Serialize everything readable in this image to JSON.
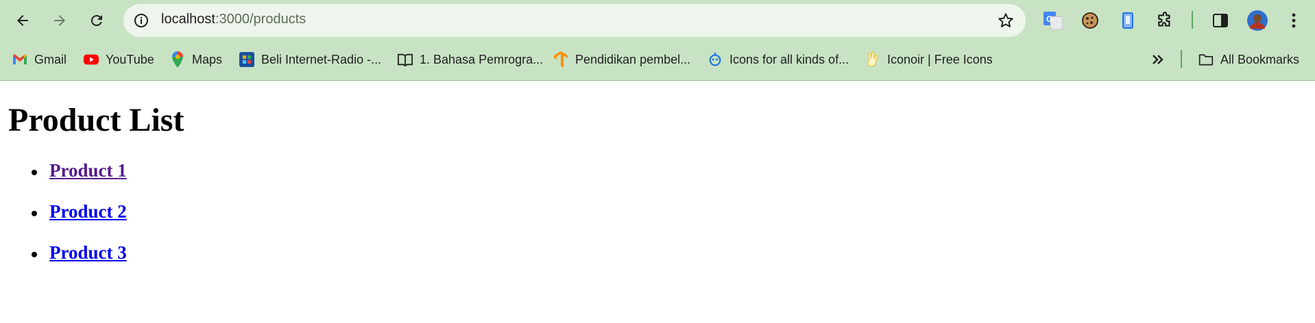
{
  "browser": {
    "back_icon": "arrow-left-icon",
    "forward_icon": "arrow-right-icon",
    "reload_icon": "reload-icon",
    "address": {
      "host": "localhost",
      "path": ":3000/products",
      "info_icon": "info-icon",
      "bookmark_icon": "star-icon"
    },
    "extensions": [
      "google-translate-icon",
      "cookie-icon",
      "phone-icon",
      "puzzle-icon"
    ],
    "side_panel_icon": "side-panel-icon",
    "profile_icon": "avatar-icon",
    "menu_icon": "kebab-menu-icon",
    "accent": "#c8e3c4"
  },
  "bookmarks": {
    "items": [
      {
        "label": "Gmail",
        "icon": "gmail-icon"
      },
      {
        "label": "YouTube",
        "icon": "youtube-icon"
      },
      {
        "label": "Maps",
        "icon": "maps-icon"
      },
      {
        "label": "Beli Internet-Radio -...",
        "icon": "radio-icon"
      },
      {
        "label": "1. Bahasa Pemrogra...",
        "icon": "book-icon"
      },
      {
        "label": "Pendidikan pembel...",
        "icon": "tensorflow-icon"
      },
      {
        "label": "Icons for all kinds of...",
        "icon": "icons-site-icon"
      },
      {
        "label": "Iconoir | Free Icons",
        "icon": "iconoir-icon"
      }
    ],
    "overflow_icon": "double-chevron-icon",
    "all_bookmarks": {
      "label": "All Bookmarks",
      "icon": "folder-icon"
    }
  },
  "page": {
    "title": "Product List",
    "products": [
      {
        "label": "Product 1",
        "visited": true
      },
      {
        "label": "Product 2",
        "visited": false
      },
      {
        "label": "Product 3",
        "visited": false
      }
    ],
    "colors": {
      "visited_link": "#551a8b",
      "link": "#0000ee"
    }
  }
}
